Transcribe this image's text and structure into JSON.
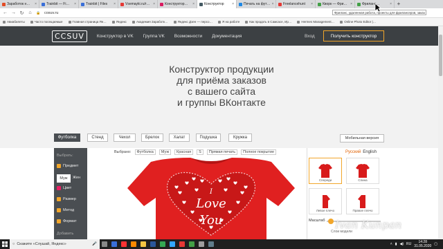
{
  "browser": {
    "tabs": [
      {
        "label": "Заработок н…",
        "color": "#e34c26"
      },
      {
        "label": "Trainbit — Fi…",
        "color": "#3a6fd8"
      },
      {
        "label": "Trainbit | Files",
        "color": "#3a6fd8"
      },
      {
        "label": "Vsemayki.ru/r…",
        "color": "#e53935"
      },
      {
        "label": "Конструктор…",
        "color": "#d81b60"
      },
      {
        "label": "Конструктор",
        "color": "#455a64",
        "active": true
      },
      {
        "label": "Печать на фут…",
        "color": "#1e88e5"
      },
      {
        "label": "Freelancehunt",
        "color": "#e53935"
      },
      {
        "label": "Кворк — Фри…",
        "color": "#43a047"
      },
      {
        "label": "Фриланс…",
        "color": "#43a047"
      }
    ],
    "new_tab": "+",
    "tooltip": "Фриланс, удаленная работа, проекты для фрилансеров, заказ работ",
    "url": "cosuv.ru",
    "bookmarks": [
      "Авиабилеты",
      "Часто посещаемые",
      "Главная страница Ян…",
      "Яндекс",
      "Академия Заработк…",
      "Яндекс Дзен — персо…",
      "Я на работе",
      "Как продать в Самсасе, Ир…",
      "Hermes Management…",
      "Online Photo Editor |…"
    ]
  },
  "site": {
    "logo": "CCSUV",
    "nav": [
      "Конструктор в VK",
      "Группа VK",
      "Возможности",
      "Документация"
    ],
    "login": "Вход",
    "cta": "Получить конструктор"
  },
  "hero": {
    "lines": [
      "Конструктор продукции",
      "для приёма заказов",
      "с вашего сайта",
      "и группы ВКонтакте"
    ]
  },
  "products": {
    "tabs": [
      "Футболка",
      "Стенд",
      "Чехол",
      "Брелок",
      "Халат",
      "Подушка",
      "Кружка"
    ],
    "mobile": "Мобильная версия"
  },
  "editor": {
    "left": {
      "choose": "Выбрать:",
      "items": [
        "Предмет",
        "Цвет",
        "Размер",
        "Метод",
        "Формат"
      ],
      "gender_male": "Муж",
      "gender_female": "Жен",
      "more": "Добавить"
    },
    "filters": [
      "Выбрано:",
      "Футболка",
      "Муж",
      "Красная",
      "S",
      "Прямая печать",
      "Полное покрытие"
    ],
    "shirt_text": [
      "I",
      "Love",
      "You"
    ],
    "shirt_color": "#e02020",
    "lang": {
      "ru": "Русский",
      "en": "English"
    },
    "views": [
      {
        "label": "Спереди",
        "active": true
      },
      {
        "label": "Спина"
      },
      {
        "label": "Левое плечо"
      },
      {
        "label": "Правое плечо"
      }
    ],
    "scale_label": "Масштаб",
    "layers": "Слои модели",
    "watermark": "Ivan Kunpan"
  },
  "taskbar": {
    "search": "Скажите «Слушай, Яндекс»",
    "lang": "RU",
    "time": "14:28",
    "date": "31.05.2020",
    "icons": [
      {
        "name": "task-view-icon",
        "color": "#888"
      },
      {
        "name": "edge-icon",
        "color": "#3a6fd8"
      },
      {
        "name": "yandex-icon",
        "color": "#ff3333"
      },
      {
        "name": "firefox-icon",
        "color": "#ff8a00"
      },
      {
        "name": "explorer-icon",
        "color": "#f4c542"
      },
      {
        "name": "word-icon",
        "color": "#2b579a"
      },
      {
        "name": "chrome-icon",
        "color": "#34a853"
      },
      {
        "name": "photoshop-icon",
        "color": "#31a8ff"
      },
      {
        "name": "app-icon",
        "color": "#e53935"
      },
      {
        "name": "camtasia-icon",
        "color": "#43a047"
      },
      {
        "name": "app2-icon",
        "color": "#9e9e9e"
      },
      {
        "name": "app3-icon",
        "color": "#607d8b"
      }
    ]
  }
}
